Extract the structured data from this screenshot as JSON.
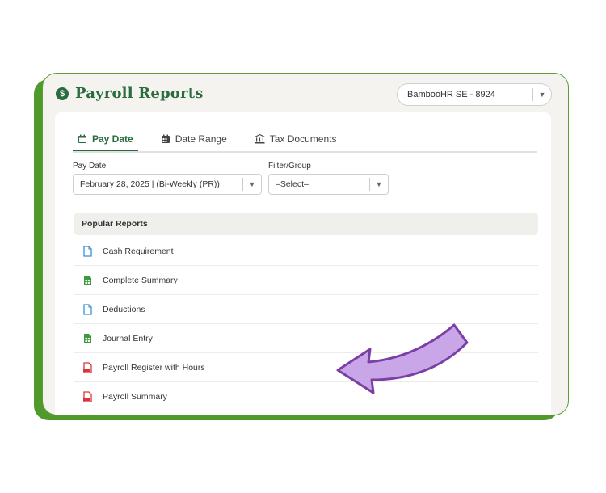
{
  "app": {
    "title": "Payroll Reports",
    "company_selector": {
      "value": "BambooHR SE - 8924"
    }
  },
  "tabs": [
    {
      "label": "Pay Date",
      "icon": "calendar-icon",
      "active": true
    },
    {
      "label": "Date Range",
      "icon": "calendar-grid-icon",
      "active": false
    },
    {
      "label": "Tax Documents",
      "icon": "bank-icon",
      "active": false
    }
  ],
  "filters": {
    "pay_date": {
      "label": "Pay Date",
      "value": "February 28, 2025 | (Bi-Weekly (PR))"
    },
    "filter_group": {
      "label": "Filter/Group",
      "value": "–Select–"
    }
  },
  "reports": {
    "header": "Popular Reports",
    "items": [
      {
        "label": "Cash Requirement",
        "icon": "document-icon"
      },
      {
        "label": "Complete Summary",
        "icon": "spreadsheet-icon"
      },
      {
        "label": "Deductions",
        "icon": "document-icon"
      },
      {
        "label": "Journal Entry",
        "icon": "spreadsheet-icon"
      },
      {
        "label": "Payroll Register with Hours",
        "icon": "pdf-icon"
      },
      {
        "label": "Payroll Summary",
        "icon": "pdf-icon"
      }
    ]
  },
  "colors": {
    "brand_green": "#2a6b3f",
    "frame_green": "#4f9a2a",
    "arrow_purple": "#c9a6e8",
    "doc_blue": "#3a8fd6",
    "sheet_green": "#3c9a3c",
    "pdf_red": "#d9343b"
  }
}
